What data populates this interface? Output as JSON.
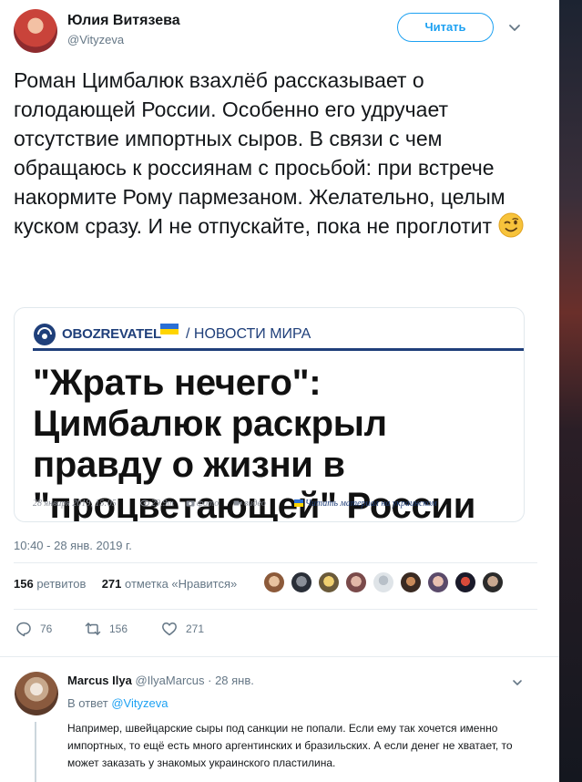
{
  "author": {
    "name": "Юлия Витязева",
    "handle": "@Vityzeva",
    "follow_label": "Читать"
  },
  "tweet": {
    "text": "Роман Цимбалюк взахлёб рассказывает о голодающей России. Особенно его удручает отсутствие импортных сыров. В связи с чем обращаюсь к россиянам с просьбой: при встрече накормите Рому пармезаном. Желательно, целым куском сразу. И не отпускайте, пока не проглотит",
    "emoji_icon": "winking-face-emoji",
    "timestamp": "10:40 - 28 янв. 2019 г."
  },
  "card": {
    "brand": "OBOZREVATEL",
    "section": "/ НОВОСТИ МИРА",
    "headline": "\"Жрать нечего\": Цимбалюк раскрыл правду о жизни в \"процветающей\" России",
    "meta": {
      "date": "28 января 2019, 15:05",
      "views": "29.9т",
      "photo": "фото",
      "video": "видео",
      "ua_link": "Читать материал на украинском"
    },
    "brand_color": "#1f3f7a"
  },
  "stats": {
    "retweets_count": "156",
    "retweets_label": "ретвитов",
    "likes_count": "271",
    "likes_label": "отметка «Нравится»",
    "likers_count": 9
  },
  "actions": {
    "reply_count": "76",
    "retweet_count": "156",
    "like_count": "271"
  },
  "reply": {
    "name": "Marcus Ilya",
    "handle": "@IlyaMarcus",
    "time": "· 28 янв.",
    "in_reply_prefix": "В ответ",
    "in_reply_handle": "@Vityzeva",
    "text": "Например, швейцарские сыры под санкции не попали. Если ему так хочется именно импортных, то ещё есть много аргентинских и бразильских. А если денег не хватает, то может заказать у знакомых украинского пластилина."
  },
  "colors": {
    "accent": "#1da1f2",
    "text": "#14171a",
    "muted": "#657786",
    "divider": "#e6ecf0"
  }
}
